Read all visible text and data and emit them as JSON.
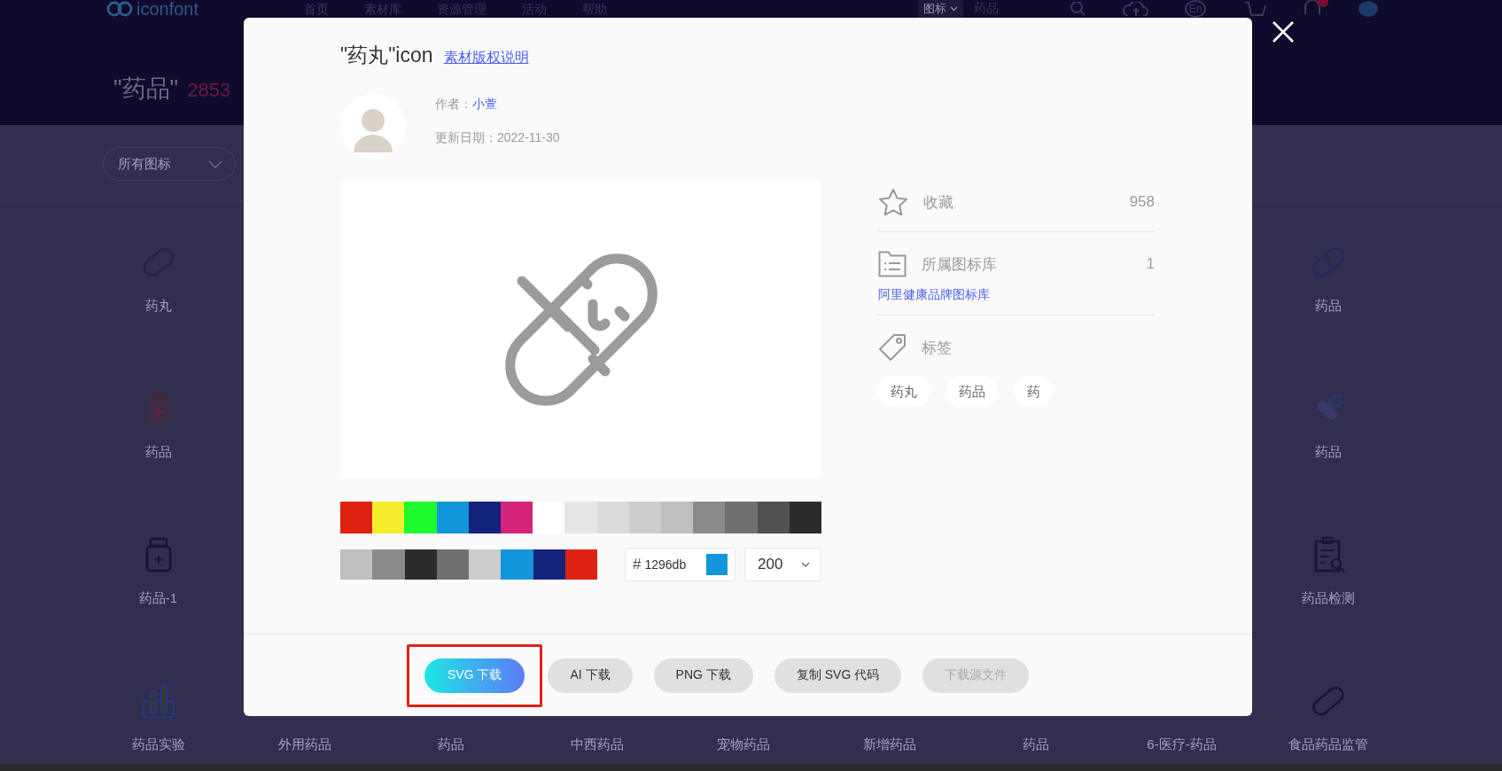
{
  "top_nav": {
    "logo": "iconfont",
    "items": [
      {
        "label": "首页"
      },
      {
        "label": "素材库"
      },
      {
        "label": "资源管理"
      },
      {
        "label": "活动"
      },
      {
        "label": "帮助"
      }
    ],
    "search_type": "图标",
    "search_value": "药品",
    "language": "En",
    "has_notification": true
  },
  "heading": {
    "title": "\"药品\"",
    "count": "2853"
  },
  "filter": {
    "value": "所有图标"
  },
  "icon_grid": {
    "left_column": [
      "药丸",
      "药品",
      "药品-1"
    ],
    "right_column": [
      "药品",
      "药品",
      "药品检测"
    ],
    "bottom_row": [
      "药品实验",
      "外用药品",
      "药品",
      "中西药品",
      "宠物药品",
      "新增药品",
      "药品",
      "6-医疗-药品",
      "食品药品监管"
    ]
  },
  "modal": {
    "title": "\"药丸\"icon",
    "copyright_link": "素材版权说明",
    "author_label": "作者：",
    "author": "小萱",
    "date_label": "更新日期：",
    "date": "2022-11-30",
    "palette": [
      {
        "color": "#dd2211"
      },
      {
        "color": "#f5ec2e"
      },
      {
        "color": "#1cfc2c"
      },
      {
        "color": "#1296db"
      },
      {
        "color": "#13227a"
      },
      {
        "color": "#d4237a"
      },
      {
        "color": "#ffffff"
      },
      {
        "color": "#e6e6e6"
      },
      {
        "color": "#dbdbdb"
      },
      {
        "color": "#cdcdcd"
      },
      {
        "color": "#bfbfbf"
      },
      {
        "color": "#8a8a8a"
      },
      {
        "color": "#707070"
      },
      {
        "color": "#515151"
      },
      {
        "color": "#2c2c2c"
      }
    ],
    "recent_colors": [
      {
        "color": "#bfbfbf"
      },
      {
        "color": "#8a8a8a"
      },
      {
        "color": "#2c2c2c"
      },
      {
        "color": "#707070"
      },
      {
        "color": "#cdcdcd"
      },
      {
        "color": "#1296db"
      },
      {
        "color": "#13227a"
      },
      {
        "color": "#dd2211"
      }
    ],
    "hex_prefix": "#",
    "hex_value": "1296db",
    "size": "200",
    "favorites": {
      "label": "收藏",
      "count": "958"
    },
    "library": {
      "label": "所属图标库",
      "count": "1",
      "link": "阿里健康品牌图标库"
    },
    "tags": {
      "label": "标签",
      "items": [
        "药丸",
        "药品",
        "药"
      ]
    },
    "buttons": [
      {
        "label": "SVG 下载",
        "kind": "primary",
        "highlighted": true,
        "disabled": false
      },
      {
        "label": "AI 下载",
        "kind": "default",
        "highlighted": false,
        "disabled": false
      },
      {
        "label": "PNG 下载",
        "kind": "default",
        "highlighted": false,
        "disabled": false
      },
      {
        "label": "复制 SVG 代码",
        "kind": "default",
        "highlighted": false,
        "disabled": false
      },
      {
        "label": "下载源文件",
        "kind": "default",
        "highlighted": false,
        "disabled": true
      }
    ]
  }
}
